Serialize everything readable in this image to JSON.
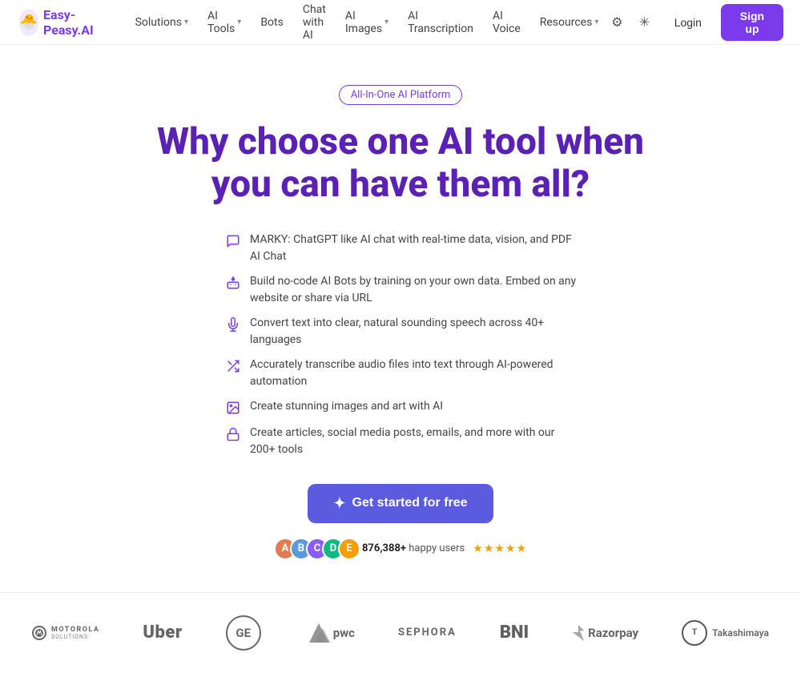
{
  "logo": {
    "emoji": "🐣",
    "text": "Easy-Peasy.AI"
  },
  "nav": {
    "items": [
      {
        "label": "Solutions",
        "hasDropdown": true
      },
      {
        "label": "AI Tools",
        "hasDropdown": true
      },
      {
        "label": "Bots",
        "hasDropdown": false
      },
      {
        "label": "Chat with AI",
        "hasDropdown": false
      },
      {
        "label": "AI Images",
        "hasDropdown": true
      },
      {
        "label": "AI Transcription",
        "hasDropdown": false
      },
      {
        "label": "AI Voice",
        "hasDropdown": false
      },
      {
        "label": "Resources",
        "hasDropdown": true
      }
    ],
    "login": "Login",
    "signup": "Sign up"
  },
  "hero": {
    "badge": "All-In-One AI Platform",
    "title": "Why choose one AI tool when you can have them all?",
    "features": [
      {
        "icon": "💬",
        "text": "MARKY: ChatGPT like AI chat with real-time data, vision, and PDF AI Chat"
      },
      {
        "icon": "🤖",
        "text": "Build no-code AI Bots by training on your own data. Embed on any website or share via URL"
      },
      {
        "icon": "🎙️",
        "text": "Convert text into clear, natural sounding speech across 40+ languages"
      },
      {
        "icon": "↔️",
        "text": "Accurately transcribe audio files into text through AI-powered automation"
      },
      {
        "icon": "🖼️",
        "text": "Create stunning images and art with AI"
      },
      {
        "icon": "🔒",
        "text": "Create articles, social media posts, emails, and more with our 200+ tools"
      }
    ],
    "cta": "Get started for free",
    "social_proof": {
      "count": "876,388+",
      "label": "happy users",
      "stars": "★★★★★"
    }
  },
  "brands": [
    {
      "name": "Motorola Solutions",
      "class": "motorola"
    },
    {
      "name": "Uber",
      "class": "uber"
    },
    {
      "name": "GE",
      "class": "ge"
    },
    {
      "name": "pwc",
      "class": "pwc"
    },
    {
      "name": "SEPHORA",
      "class": "sephora"
    },
    {
      "name": "BNI",
      "class": "bni"
    },
    {
      "name": "Razorpay",
      "class": "razorpay"
    },
    {
      "name": "Takashimaya",
      "class": "takashimaya"
    }
  ]
}
